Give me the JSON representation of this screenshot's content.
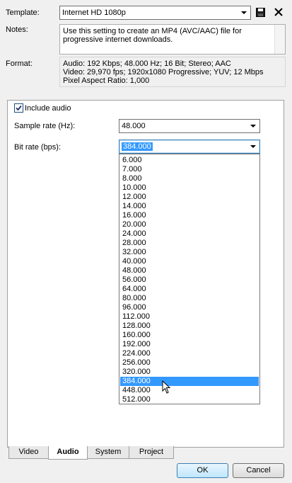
{
  "template": {
    "label": "Template:",
    "value": "Internet HD 1080p"
  },
  "notes": {
    "label": "Notes:",
    "line1": "Use this setting to create an MP4 (AVC/AAC) file for",
    "line2": "progressive internet downloads."
  },
  "format": {
    "label": "Format:",
    "line1": "Audio: 192 Kbps; 48.000 Hz; 16 Bit; Stereo; AAC",
    "line2": "Video: 29,970 fps; 1920x1080 Progressive; YUV; 12 Mbps",
    "line3": "Pixel Aspect Ratio: 1,000"
  },
  "audio": {
    "include_audio_label": "Include audio",
    "include_audio_checked": true,
    "sample_rate_label": "Sample rate (Hz):",
    "sample_rate_value": "48.000",
    "bit_rate_label": "Bit rate (bps):",
    "bit_rate_value": "384.000",
    "bit_rate_options": [
      "6.000",
      "7.000",
      "8.000",
      "10.000",
      "12.000",
      "14.000",
      "16.000",
      "20.000",
      "24.000",
      "28.000",
      "32.000",
      "40.000",
      "48.000",
      "56.000",
      "64.000",
      "80.000",
      "96.000",
      "112.000",
      "128.000",
      "160.000",
      "192.000",
      "224.000",
      "256.000",
      "320.000",
      "384.000",
      "448.000",
      "512.000"
    ],
    "selected_option": "384.000"
  },
  "tabs": [
    "Video",
    "Audio",
    "System",
    "Project"
  ],
  "active_tab": "Audio",
  "buttons": {
    "ok": "OK",
    "cancel": "Cancel"
  },
  "icons": {
    "save": "floppy-disk-icon",
    "delete": "close-x-icon",
    "cursor": "mouse-pointer-icon"
  },
  "colors": {
    "selection": "#3399ff",
    "window_bg": "#f0f0f0"
  }
}
